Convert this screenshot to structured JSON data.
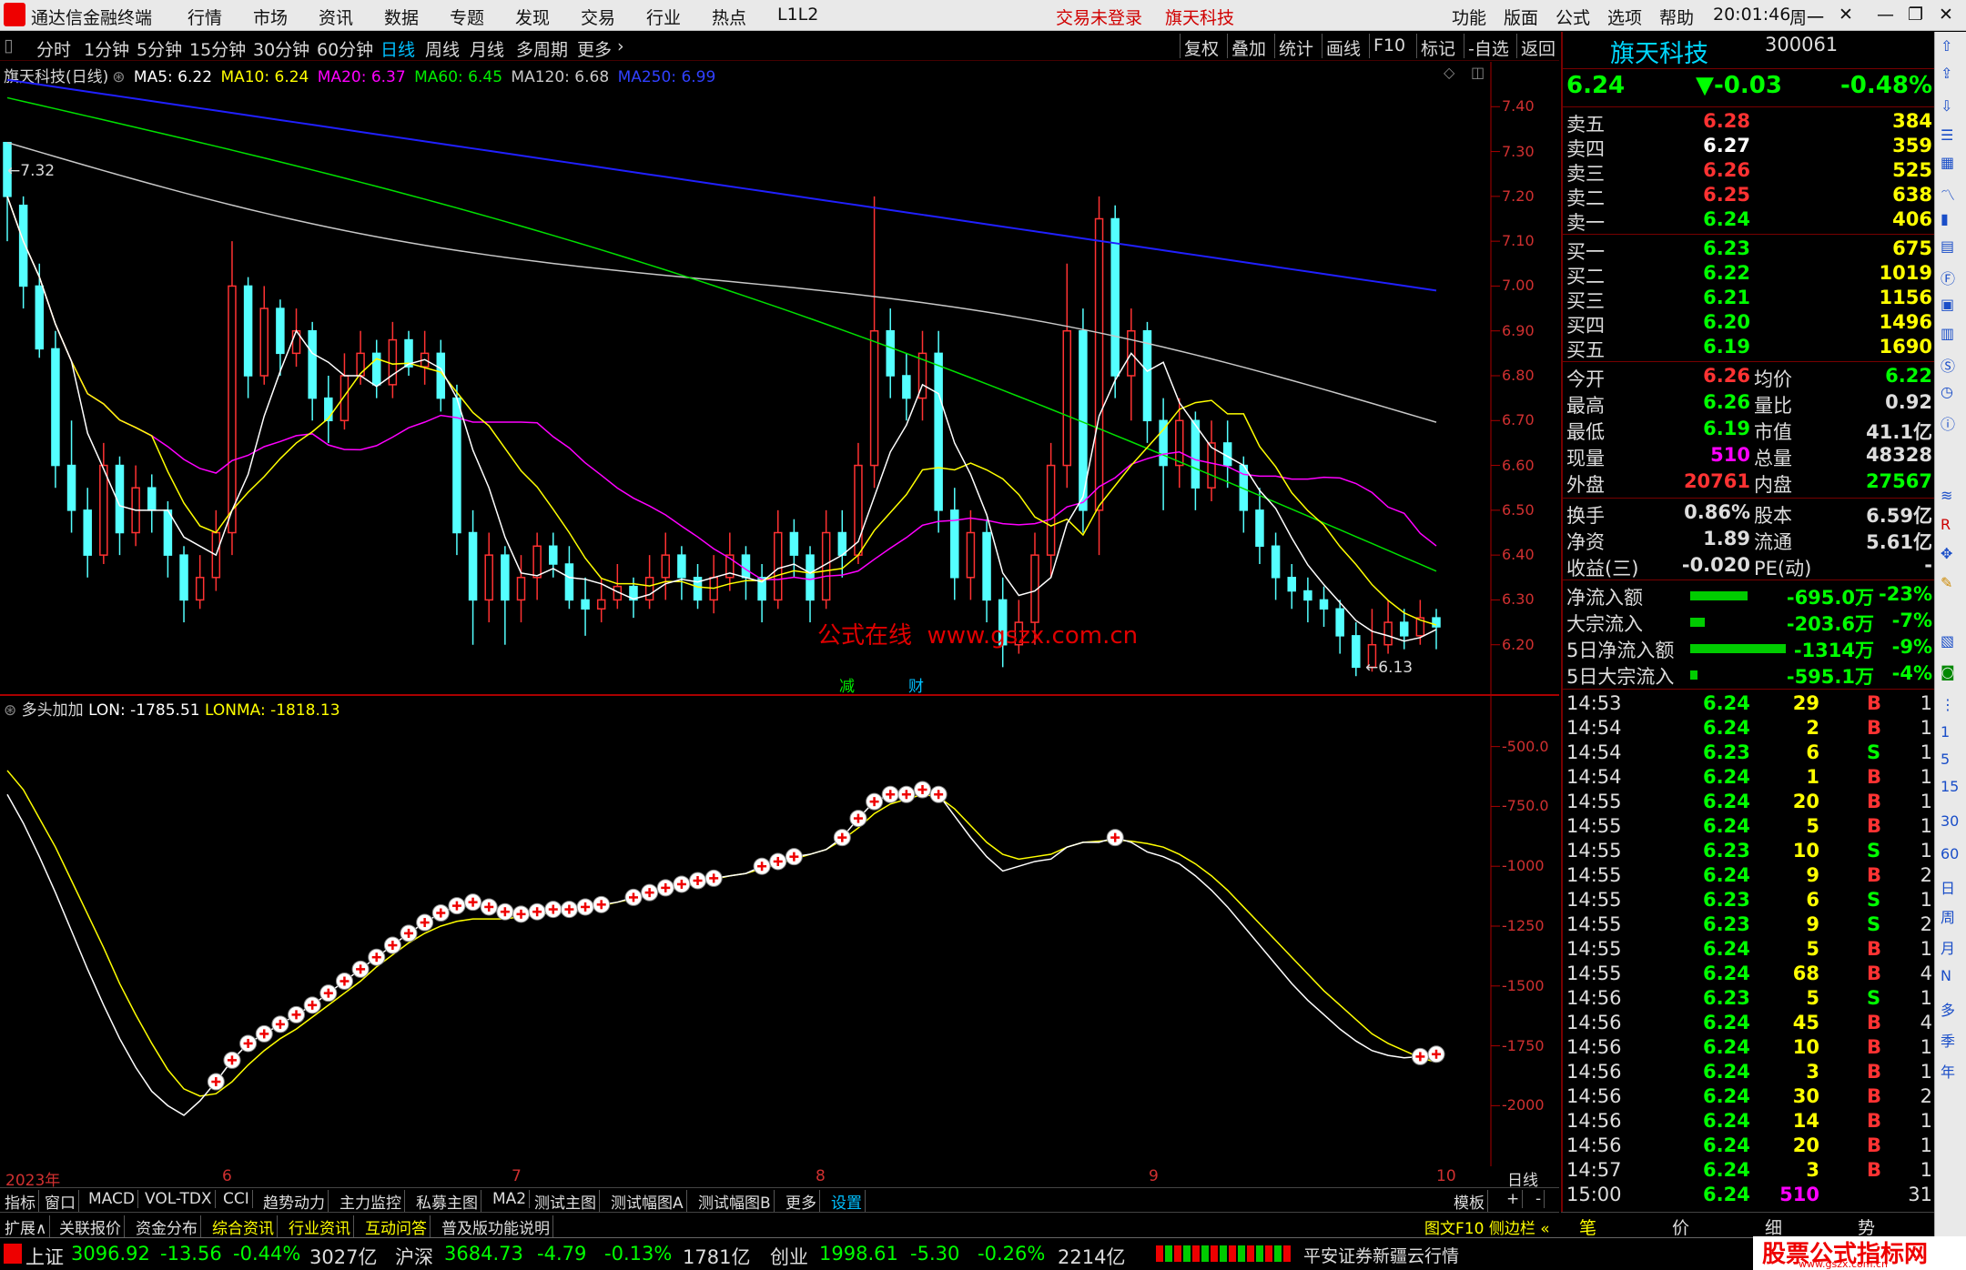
{
  "titlebar": {
    "logo": "通达信金融终端",
    "menus": [
      "行情",
      "市场",
      "资讯",
      "数据",
      "专题",
      "发现",
      "交易",
      "行业",
      "热点",
      "L1L2"
    ],
    "status1": "交易未登录",
    "status2": "旗天科技",
    "right_menus": [
      "功能",
      "版面",
      "公式",
      "选项",
      "帮助"
    ],
    "time": "20:01:46",
    "weekday": "周一"
  },
  "toolbar": {
    "periods": [
      "分时",
      "1分钟",
      "5分钟",
      "15分钟",
      "30分钟",
      "60分钟",
      "日线",
      "周线",
      "月线",
      "多周期",
      "更多"
    ],
    "active": "日线",
    "right": [
      "复权",
      "叠加",
      "统计",
      "画线",
      "F10",
      "标记",
      "-自选",
      "返回"
    ]
  },
  "main_legend": {
    "title": "旗天科技(日线)",
    "ma5": "MA5: 6.22",
    "ma10": "MA10: 6.24",
    "ma20": "MA20: 6.37",
    "ma60": "MA60: 6.45",
    "ma120": "MA120: 6.68",
    "ma250": "MA250: 6.99"
  },
  "colors": {
    "up": "#ff3232",
    "down": "#54ffff",
    "ma5": "#ffffff",
    "ma10": "#ffff00",
    "ma20": "#ff00ff",
    "ma60": "#00e000",
    "ma120": "#c8c8c8",
    "ma250": "#2020ff",
    "lon": "#ffffff",
    "lonma": "#ffff00"
  },
  "price_axis": [
    "7.40",
    "7.30",
    "7.20",
    "7.10",
    "7.00",
    "6.90",
    "6.80",
    "6.70",
    "6.60",
    "6.50",
    "6.40",
    "6.30",
    "6.20"
  ],
  "annotations": {
    "high": "7.32",
    "low": "6.13",
    "watermark": "公式在线  www.gszx.com.cn",
    "mark1": "减",
    "mark2": "财"
  },
  "indicator": {
    "name": "多头加加",
    "lon": "LON: -1785.51",
    "lonma": "LONMA: -1818.13",
    "axis": [
      "-500.0",
      "-750.0",
      "-1000",
      "-1250",
      "-1500",
      "-1750",
      "-2000"
    ]
  },
  "xaxis": [
    "2023年",
    "6",
    "7",
    "8",
    "9",
    "10"
  ],
  "xaxis_right": "日线",
  "tabs": [
    "指标",
    "窗口",
    "MACD",
    "VOL-TDX",
    "CCI",
    "趋势动力",
    "主力监控",
    "私募主图",
    "MA2",
    "测试主图",
    "测试幅图A",
    "测试幅图B",
    "更多",
    "设置"
  ],
  "tabs_right": [
    "模板",
    "+",
    "-"
  ],
  "tabs2": [
    "扩展∧",
    "关联报价",
    "资金分布",
    "综合资讯",
    "行业资讯",
    "互动问答",
    "普及版功能说明"
  ],
  "tabs2_right": "图文F10 侧边栏 «",
  "quote": {
    "name": "旗天科技",
    "code": "300061",
    "price": "6.24",
    "change": "▼-0.03",
    "pct": "-0.48%",
    "sell": [
      [
        "卖五",
        "6.28",
        "384"
      ],
      [
        "卖四",
        "6.27",
        "359"
      ],
      [
        "卖三",
        "6.26",
        "525"
      ],
      [
        "卖二",
        "6.25",
        "638"
      ],
      [
        "卖一",
        "6.24",
        "406"
      ]
    ],
    "buy": [
      [
        "买一",
        "6.23",
        "675"
      ],
      [
        "买二",
        "6.22",
        "1019"
      ],
      [
        "买三",
        "6.21",
        "1156"
      ],
      [
        "买四",
        "6.20",
        "1496"
      ],
      [
        "买五",
        "6.19",
        "1690"
      ]
    ],
    "stats": [
      [
        "今开",
        "6.26",
        "均价",
        "6.22"
      ],
      [
        "最高",
        "6.26",
        "量比",
        "0.92"
      ],
      [
        "最低",
        "6.19",
        "市值",
        "41.1亿"
      ],
      [
        "现量",
        "510",
        "总量",
        "48328"
      ],
      [
        "外盘",
        "20761",
        "内盘",
        "27567"
      ]
    ],
    "stats2": [
      [
        "换手",
        "0.86%",
        "股本",
        "6.59亿"
      ],
      [
        "净资",
        "1.89",
        "流通",
        "5.61亿"
      ],
      [
        "收益(三)",
        "-0.020",
        "PE(动)",
        "-"
      ]
    ],
    "flow": [
      [
        "净流入额",
        "-695.0万",
        "-23%",
        60
      ],
      [
        "大宗流入",
        "-203.6万",
        "-7%",
        15
      ],
      [
        "5日净流入额",
        "-1314万",
        "-9%",
        100
      ],
      [
        "5日大宗流入",
        "-595.1万",
        "-4%",
        8
      ]
    ],
    "ticks": [
      [
        "14:53",
        "6.24",
        "29",
        "B",
        "1"
      ],
      [
        "14:54",
        "6.24",
        "2",
        "B",
        "1"
      ],
      [
        "14:54",
        "6.23",
        "6",
        "S",
        "1"
      ],
      [
        "14:54",
        "6.24",
        "1",
        "B",
        "1"
      ],
      [
        "14:55",
        "6.24",
        "20",
        "B",
        "1"
      ],
      [
        "14:55",
        "6.24",
        "5",
        "B",
        "1"
      ],
      [
        "14:55",
        "6.23",
        "10",
        "S",
        "1"
      ],
      [
        "14:55",
        "6.24",
        "9",
        "B",
        "2"
      ],
      [
        "14:55",
        "6.23",
        "6",
        "S",
        "1"
      ],
      [
        "14:55",
        "6.23",
        "9",
        "S",
        "2"
      ],
      [
        "14:55",
        "6.24",
        "5",
        "B",
        "1"
      ],
      [
        "14:55",
        "6.24",
        "68",
        "B",
        "4"
      ],
      [
        "14:56",
        "6.23",
        "5",
        "S",
        "1"
      ],
      [
        "14:56",
        "6.24",
        "45",
        "B",
        "4"
      ],
      [
        "14:56",
        "6.24",
        "10",
        "B",
        "1"
      ],
      [
        "14:56",
        "6.24",
        "3",
        "B",
        "1"
      ],
      [
        "14:56",
        "6.24",
        "30",
        "B",
        "2"
      ],
      [
        "14:56",
        "6.24",
        "14",
        "B",
        "1"
      ],
      [
        "14:56",
        "6.24",
        "20",
        "B",
        "1"
      ],
      [
        "14:57",
        "6.24",
        "3",
        "B",
        "1"
      ],
      [
        "15:00",
        "6.24",
        "510",
        "",
        "31"
      ]
    ]
  },
  "right_bottom_tabs": [
    "笔",
    "价",
    "细",
    "势"
  ],
  "status": {
    "sh": "上证",
    "sh_v": "3096.92",
    "sh_c": "-13.56",
    "sh_p": "-0.44%",
    "sh_a": "3027亿",
    "sz": "沪深",
    "sz_v": "3684.73",
    "sz_c": "-4.79",
    "sz_p": "-0.13%",
    "sz_a": "1781亿",
    "cy": "创业",
    "cy_v": "1998.61",
    "cy_c": "-5.30",
    "cy_p": "-0.26%",
    "cy_a": "2214亿",
    "broker": "平安证券新疆云行情",
    "brand": "股票公式指标网",
    "brand_url": "www.gszx.com.cn"
  },
  "side_tools": [
    "日",
    "周",
    "月",
    "N",
    "多",
    "季",
    "年"
  ],
  "side_nums": [
    "1",
    "5",
    "15",
    "30",
    "60"
  ],
  "chart_data": {
    "type": "candlestick",
    "title": "旗天科技(日线)",
    "ylim": [
      6.1,
      7.5
    ],
    "candles": [
      [
        7.32,
        7.2,
        7.3,
        7.1
      ],
      [
        7.18,
        7.0,
        7.2,
        6.95
      ],
      [
        7.0,
        6.86,
        7.05,
        6.84
      ],
      [
        6.86,
        6.6,
        6.9,
        6.55
      ],
      [
        6.6,
        6.5,
        6.7,
        6.45
      ],
      [
        6.5,
        6.4,
        6.55,
        6.35
      ],
      [
        6.4,
        6.6,
        6.65,
        6.38
      ],
      [
        6.6,
        6.45,
        6.62,
        6.4
      ],
      [
        6.45,
        6.55,
        6.6,
        6.42
      ],
      [
        6.55,
        6.5,
        6.58,
        6.45
      ],
      [
        6.5,
        6.4,
        6.52,
        6.35
      ],
      [
        6.4,
        6.3,
        6.42,
        6.25
      ],
      [
        6.3,
        6.35,
        6.4,
        6.28
      ],
      [
        6.35,
        6.45,
        6.5,
        6.32
      ],
      [
        6.45,
        7.0,
        7.1,
        6.4
      ],
      [
        7.0,
        6.8,
        7.02,
        6.75
      ],
      [
        6.8,
        6.95,
        7.0,
        6.78
      ],
      [
        6.95,
        6.85,
        6.97,
        6.8
      ],
      [
        6.85,
        6.9,
        6.95,
        6.82
      ],
      [
        6.9,
        6.75,
        6.92,
        6.7
      ],
      [
        6.75,
        6.7,
        6.8,
        6.65
      ],
      [
        6.7,
        6.8,
        6.85,
        6.68
      ],
      [
        6.8,
        6.85,
        6.9,
        6.78
      ],
      [
        6.85,
        6.78,
        6.88,
        6.75
      ],
      [
        6.78,
        6.88,
        6.92,
        6.75
      ],
      [
        6.88,
        6.82,
        6.9,
        6.8
      ],
      [
        6.82,
        6.85,
        6.9,
        6.78
      ],
      [
        6.85,
        6.75,
        6.88,
        6.72
      ],
      [
        6.75,
        6.45,
        6.78,
        6.4
      ],
      [
        6.45,
        6.3,
        6.5,
        6.2
      ],
      [
        6.3,
        6.4,
        6.45,
        6.25
      ],
      [
        6.4,
        6.3,
        6.42,
        6.2
      ],
      [
        6.3,
        6.35,
        6.4,
        6.25
      ],
      [
        6.35,
        6.42,
        6.45,
        6.3
      ],
      [
        6.42,
        6.38,
        6.45,
        6.35
      ],
      [
        6.38,
        6.3,
        6.42,
        6.28
      ],
      [
        6.3,
        6.28,
        6.35,
        6.22
      ],
      [
        6.28,
        6.3,
        6.35,
        6.25
      ],
      [
        6.3,
        6.33,
        6.38,
        6.28
      ],
      [
        6.33,
        6.3,
        6.35,
        6.26
      ],
      [
        6.3,
        6.35,
        6.4,
        6.28
      ],
      [
        6.35,
        6.4,
        6.45,
        6.3
      ],
      [
        6.4,
        6.35,
        6.42,
        6.3
      ],
      [
        6.35,
        6.3,
        6.38,
        6.28
      ],
      [
        6.3,
        6.35,
        6.4,
        6.27
      ],
      [
        6.35,
        6.4,
        6.45,
        6.32
      ],
      [
        6.4,
        6.35,
        6.42,
        6.3
      ],
      [
        6.35,
        6.3,
        6.38,
        6.25
      ],
      [
        6.3,
        6.45,
        6.5,
        6.28
      ],
      [
        6.45,
        6.4,
        6.48,
        6.35
      ],
      [
        6.4,
        6.3,
        6.42,
        6.25
      ],
      [
        6.3,
        6.45,
        6.5,
        6.28
      ],
      [
        6.45,
        6.4,
        6.5,
        6.35
      ],
      [
        6.4,
        6.6,
        6.65,
        6.38
      ],
      [
        6.6,
        6.9,
        7.2,
        6.55
      ],
      [
        6.9,
        6.8,
        6.95,
        6.75
      ],
      [
        6.8,
        6.75,
        6.85,
        6.7
      ],
      [
        6.75,
        6.85,
        6.9,
        6.7
      ],
      [
        6.85,
        6.5,
        6.9,
        6.45
      ],
      [
        6.5,
        6.35,
        6.55,
        6.3
      ],
      [
        6.35,
        6.45,
        6.5,
        6.3
      ],
      [
        6.45,
        6.3,
        6.48,
        6.25
      ],
      [
        6.3,
        6.2,
        6.35,
        6.15
      ],
      [
        6.2,
        6.25,
        6.3,
        6.18
      ],
      [
        6.25,
        6.4,
        6.45,
        6.2
      ],
      [
        6.4,
        6.6,
        6.65,
        6.35
      ],
      [
        6.6,
        6.9,
        7.05,
        6.55
      ],
      [
        6.9,
        6.5,
        6.95,
        6.45
      ],
      [
        6.5,
        7.15,
        7.2,
        6.4
      ],
      [
        7.15,
        6.8,
        7.18,
        6.75
      ],
      [
        6.8,
        6.9,
        6.95,
        6.7
      ],
      [
        6.9,
        6.7,
        6.92,
        6.65
      ],
      [
        6.7,
        6.6,
        6.75,
        6.5
      ],
      [
        6.6,
        6.7,
        6.75,
        6.55
      ],
      [
        6.7,
        6.55,
        6.72,
        6.5
      ],
      [
        6.55,
        6.65,
        6.7,
        6.52
      ],
      [
        6.65,
        6.6,
        6.7,
        6.55
      ],
      [
        6.6,
        6.5,
        6.62,
        6.45
      ],
      [
        6.5,
        6.42,
        6.55,
        6.38
      ],
      [
        6.42,
        6.35,
        6.45,
        6.3
      ],
      [
        6.35,
        6.32,
        6.38,
        6.28
      ],
      [
        6.32,
        6.3,
        6.35,
        6.25
      ],
      [
        6.3,
        6.28,
        6.33,
        6.24
      ],
      [
        6.28,
        6.22,
        6.3,
        6.18
      ],
      [
        6.22,
        6.15,
        6.25,
        6.13
      ],
      [
        6.15,
        6.2,
        6.28,
        6.14
      ],
      [
        6.2,
        6.25,
        6.3,
        6.18
      ],
      [
        6.25,
        6.22,
        6.28,
        6.19
      ],
      [
        6.22,
        6.26,
        6.3,
        6.2
      ],
      [
        6.26,
        6.24,
        6.28,
        6.19
      ]
    ],
    "lon": [
      -700,
      -820,
      -960,
      -1110,
      -1270,
      -1430,
      -1580,
      -1720,
      -1840,
      -1940,
      -2000,
      -2040,
      -1980,
      -1900,
      -1810,
      -1740,
      -1700,
      -1660,
      -1620,
      -1580,
      -1530,
      -1480,
      -1430,
      -1380,
      -1330,
      -1280,
      -1235,
      -1195,
      -1165,
      -1150,
      -1170,
      -1190,
      -1200,
      -1190,
      -1180,
      -1180,
      -1170,
      -1160,
      -1150,
      -1130,
      -1110,
      -1090,
      -1075,
      -1060,
      -1050,
      -1040,
      -1030,
      -1000,
      -980,
      -960,
      -950,
      -930,
      -880,
      -800,
      -730,
      -700,
      -700,
      -680,
      -700,
      -790,
      -880,
      -960,
      -1020,
      -1000,
      -980,
      -970,
      -920,
      -900,
      -900,
      -880,
      -900,
      -940,
      -960,
      -990,
      -1040,
      -1100,
      -1170,
      -1250,
      -1330,
      -1410,
      -1490,
      -1560,
      -1620,
      -1680,
      -1730,
      -1770,
      -1790,
      -1800,
      -1795,
      -1785
    ],
    "lonma": [
      -600,
      -680,
      -800,
      -920,
      -1060,
      -1200,
      -1340,
      -1490,
      -1620,
      -1740,
      -1850,
      -1930,
      -1960,
      -1950,
      -1900,
      -1830,
      -1770,
      -1720,
      -1680,
      -1630,
      -1580,
      -1530,
      -1480,
      -1420,
      -1370,
      -1320,
      -1280,
      -1250,
      -1230,
      -1220,
      -1220,
      -1220,
      -1210,
      -1200,
      -1195,
      -1185,
      -1175,
      -1165,
      -1150,
      -1135,
      -1115,
      -1100,
      -1085,
      -1070,
      -1055,
      -1040,
      -1030,
      -1010,
      -990,
      -970,
      -950,
      -930,
      -890,
      -840,
      -780,
      -740,
      -720,
      -700,
      -710,
      -760,
      -830,
      -900,
      -950,
      -970,
      -960,
      -950,
      -920,
      -900,
      -895,
      -890,
      -895,
      -905,
      -920,
      -950,
      -990,
      -1040,
      -1100,
      -1170,
      -1240,
      -1310,
      -1380,
      -1450,
      -1520,
      -1580,
      -1640,
      -1700,
      -1740,
      -1770,
      -1800,
      -1818
    ]
  }
}
